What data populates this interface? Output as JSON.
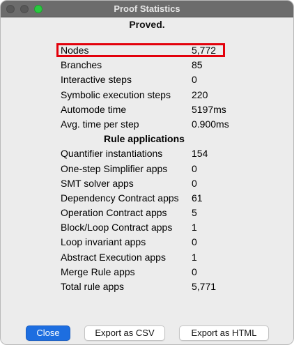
{
  "window": {
    "title": "Proof Statistics"
  },
  "status": "Proved.",
  "stats": [
    {
      "label": "Nodes",
      "value": "5,772"
    },
    {
      "label": "Branches",
      "value": "85"
    },
    {
      "label": "Interactive steps",
      "value": "0"
    },
    {
      "label": "Symbolic execution steps",
      "value": "220"
    },
    {
      "label": "Automode time",
      "value": "5197ms"
    },
    {
      "label": "Avg. time per step",
      "value": "0.900ms"
    }
  ],
  "rule_section_title": "Rule applications",
  "rules": [
    {
      "label": "Quantifier instantiations",
      "value": "154"
    },
    {
      "label": "One-step Simplifier apps",
      "value": "0"
    },
    {
      "label": "SMT solver apps",
      "value": "0"
    },
    {
      "label": "Dependency Contract apps",
      "value": "61"
    },
    {
      "label": "Operation Contract apps",
      "value": "5"
    },
    {
      "label": "Block/Loop Contract apps",
      "value": "1"
    },
    {
      "label": "Loop invariant apps",
      "value": "0"
    },
    {
      "label": "Abstract Execution apps",
      "value": "1"
    },
    {
      "label": "Merge Rule apps",
      "value": "0"
    },
    {
      "label": "Total rule apps",
      "value": "5,771"
    }
  ],
  "buttons": {
    "close": "Close",
    "export_csv": "Export as CSV",
    "export_html": "Export as HTML"
  },
  "colors": {
    "titlebar": "#6c6c6c",
    "window_bg": "#ececec",
    "highlight": "#e3000b",
    "primary_button": "#1d6ee0",
    "traffic_green": "#29c940"
  }
}
